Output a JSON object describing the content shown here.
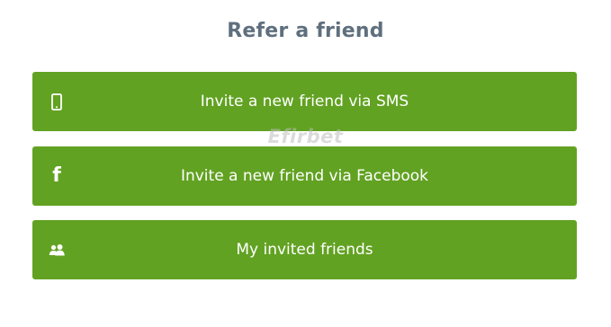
{
  "page": {
    "title": "Refer a friend",
    "watermark": "Efirbet"
  },
  "buttons": [
    {
      "label": "Invite a new friend via SMS",
      "icon": "mobile-phone-icon"
    },
    {
      "label": "Invite a new friend via Facebook",
      "icon": "facebook-icon",
      "icon_glyph": "f"
    },
    {
      "label": "My invited friends",
      "icon": "users-icon"
    }
  ],
  "colors": {
    "button_bg": "#62a222",
    "title": "#5f6f7e",
    "button_text": "#ffffff"
  }
}
